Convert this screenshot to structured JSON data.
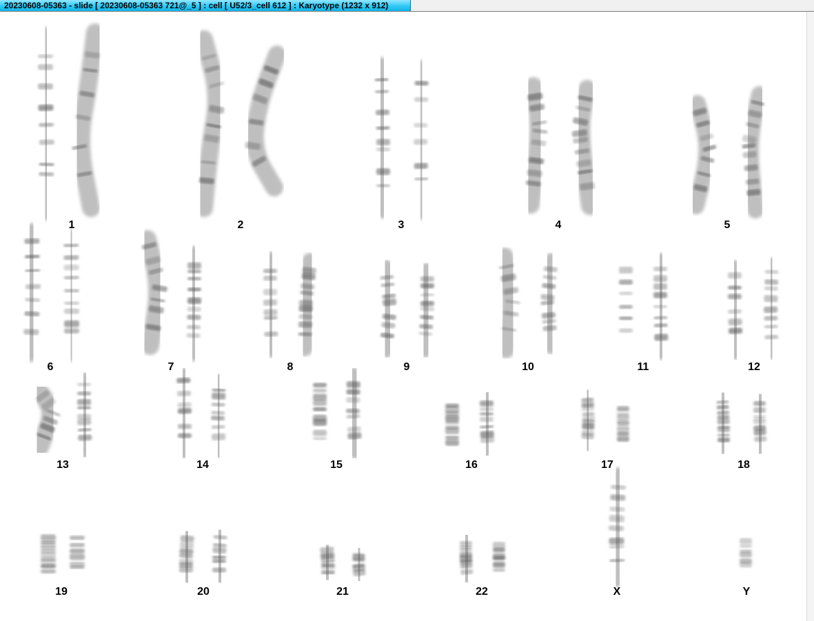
{
  "window": {
    "title": "20230608-05363 - slide [ 20230608-05363 721@_5 ] : cell [ U52/3_cell 612 ] : Karyotype  (1232 x 912)"
  },
  "karyotype": {
    "labels": [
      "1",
      "2",
      "3",
      "4",
      "5",
      "6",
      "7",
      "8",
      "9",
      "10",
      "11",
      "12",
      "13",
      "14",
      "15",
      "16",
      "17",
      "18",
      "19",
      "20",
      "21",
      "22",
      "X",
      "Y"
    ]
  },
  "colors": {
    "titlebar_accent": "#2fc8f5",
    "chromosome_gray": "#8a8a8a",
    "band_dark": "#555555"
  }
}
